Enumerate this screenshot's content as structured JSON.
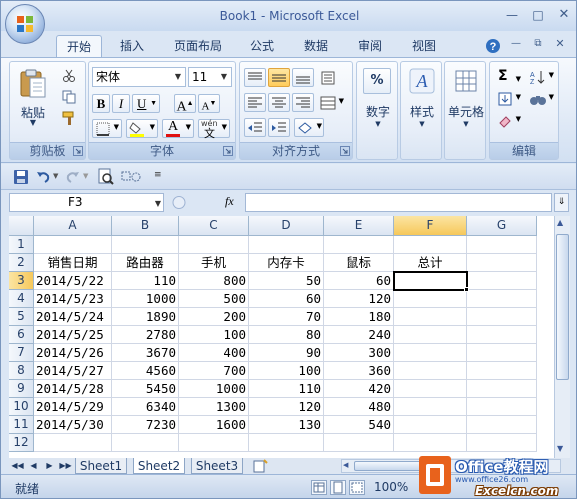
{
  "window": {
    "title": "Book1 - Microsoft Excel"
  },
  "ribbon_tabs": [
    "开始",
    "插入",
    "页面布局",
    "公式",
    "数据",
    "审阅",
    "视图"
  ],
  "ribbon": {
    "clipboard": {
      "paste": "粘贴",
      "label": "剪贴板"
    },
    "font": {
      "name": "宋体",
      "size": "11",
      "bold": "B",
      "italic": "I",
      "underline": "U",
      "grow": "A",
      "shrink": "A",
      "color_letter": "A",
      "phonetic": "wén",
      "label": "字体"
    },
    "alignment": {
      "label": "对齐方式"
    },
    "number": {
      "icon_text": "%",
      "label": "数字"
    },
    "styles": {
      "label": "样式"
    },
    "cells": {
      "label": "单元格"
    },
    "editing": {
      "label": "编辑"
    }
  },
  "formula_bar": {
    "name_box": "F3",
    "fx": "fx",
    "formula": ""
  },
  "grid": {
    "columns": [
      "A",
      "B",
      "C",
      "D",
      "E",
      "F",
      "G"
    ],
    "selected_column": "F",
    "selected_row": 3,
    "rows": [
      {
        "num": "1",
        "cells": [
          "",
          "",
          "",
          "",
          "",
          "",
          ""
        ]
      },
      {
        "num": "2",
        "cells": [
          "销售日期",
          "路由器",
          "手机",
          "内存卡",
          "鼠标",
          "总计",
          ""
        ]
      },
      {
        "num": "3",
        "cells": [
          "2014/5/22",
          "110",
          "800",
          "50",
          "60",
          "",
          ""
        ]
      },
      {
        "num": "4",
        "cells": [
          "2014/5/23",
          "1000",
          "500",
          "60",
          "120",
          "",
          ""
        ]
      },
      {
        "num": "5",
        "cells": [
          "2014/5/24",
          "1890",
          "200",
          "70",
          "180",
          "",
          ""
        ]
      },
      {
        "num": "6",
        "cells": [
          "2014/5/25",
          "2780",
          "100",
          "80",
          "240",
          "",
          ""
        ]
      },
      {
        "num": "7",
        "cells": [
          "2014/5/26",
          "3670",
          "400",
          "90",
          "300",
          "",
          ""
        ]
      },
      {
        "num": "8",
        "cells": [
          "2014/5/27",
          "4560",
          "700",
          "100",
          "360",
          "",
          ""
        ]
      },
      {
        "num": "9",
        "cells": [
          "2014/5/28",
          "5450",
          "1000",
          "110",
          "420",
          "",
          ""
        ]
      },
      {
        "num": "10",
        "cells": [
          "2014/5/29",
          "6340",
          "1300",
          "120",
          "480",
          "",
          ""
        ]
      },
      {
        "num": "11",
        "cells": [
          "2014/5/30",
          "7230",
          "1600",
          "130",
          "540",
          "",
          ""
        ]
      },
      {
        "num": "12",
        "cells": [
          "",
          "",
          "",
          "",
          "",
          "",
          ""
        ]
      }
    ]
  },
  "sheets": [
    "Sheet1",
    "Sheet2",
    "Sheet3"
  ],
  "active_sheet": "Sheet2",
  "status": {
    "text": "就绪",
    "zoom": "100%"
  },
  "watermark": {
    "line1": "Office教程网",
    "line2": "www.office26.com",
    "line3": "Excelcn.com"
  }
}
